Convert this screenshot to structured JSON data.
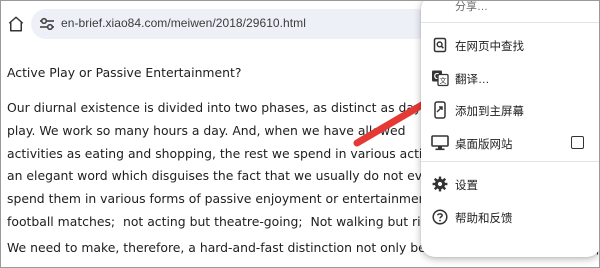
{
  "browser": {
    "url": "en-brief.xiao84.com/meiwen/2018/29610.html",
    "icons": {
      "home": "home-icon",
      "site_info": "tune-icon"
    }
  },
  "article": {
    "title": "Active Play or Passive Entertainment?",
    "paragraph1": [
      "Our diurnal existence is divided into two phases, as distinct as day and",
      "play. We work so many hours a day. And, when we have allowed",
      "activities as eating and shopping, the rest we spend in various activities v",
      "an elegant word which disguises the fact that we usually do not even p",
      "spend them in various forms of passive enjoyment or entertainment—no",
      "football matches;  not acting but theatre-going;  Not walking but riding i"
    ],
    "paragraph2": [
      "We need to make, therefore, a hard-and-fast distinction not only between work and play but equally"
    ]
  },
  "menu": {
    "partial_top_label": "分享…",
    "items": [
      {
        "label": "在网页中查找",
        "icon": "find-in-page-icon"
      },
      {
        "label": "翻译…",
        "icon": "translate-icon"
      },
      {
        "label": "添加到主屏幕",
        "icon": "add-to-home-screen-icon"
      },
      {
        "label": "桌面版网站",
        "icon": "desktop-icon",
        "checkbox_checked": false
      },
      {
        "label": "设置",
        "icon": "gear-icon"
      },
      {
        "label": "帮助和反馈",
        "icon": "help-icon"
      }
    ]
  },
  "annotation": {
    "arrow_color": "#e53935",
    "icon": "red-arrow-icon"
  }
}
